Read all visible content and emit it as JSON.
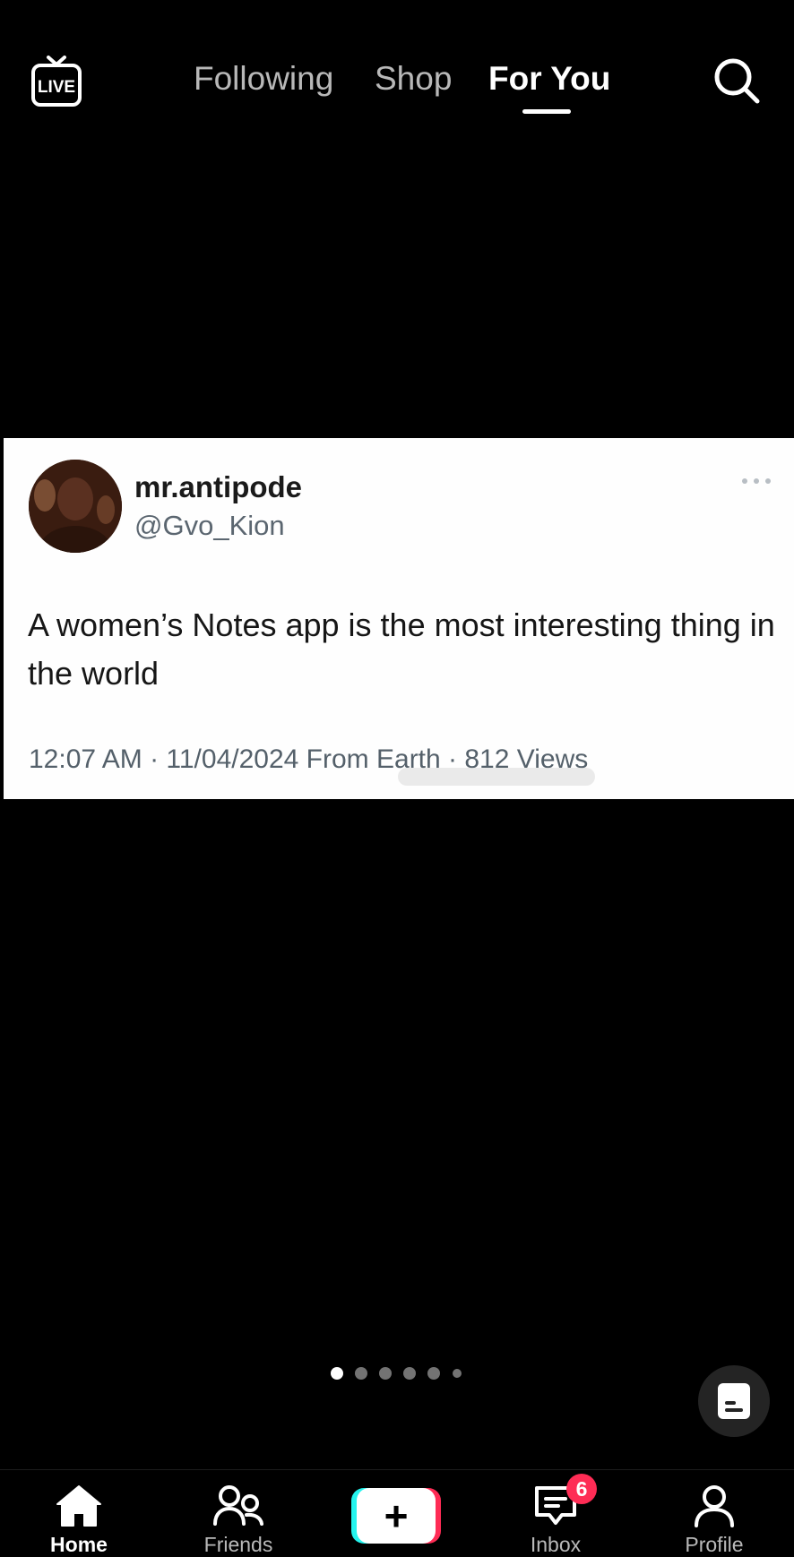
{
  "top_nav": {
    "live_label": "LIVE",
    "tabs": [
      {
        "label": "Following",
        "active": false
      },
      {
        "label": "Shop",
        "active": false
      },
      {
        "label": "For You",
        "active": true
      }
    ],
    "search_icon": "search-icon"
  },
  "post": {
    "display_name": "mr.antipode",
    "handle": "@Gvo_Kion",
    "text": "A women’s Notes app is the most interesting thing in the world",
    "meta": "12:07 AM · 11/04/2024 From Earth · 812 Views",
    "more_icon": "ellipsis-icon"
  },
  "carousel": {
    "count": 6,
    "active_index": 0
  },
  "floating_button": {
    "icon": "notes-icon"
  },
  "bottom_nav": {
    "items": [
      {
        "label": "Home",
        "icon": "home-icon",
        "active": true
      },
      {
        "label": "Friends",
        "icon": "friends-icon",
        "active": false
      },
      {
        "label": "Inbox",
        "icon": "inbox-icon",
        "active": false,
        "badge": "6"
      },
      {
        "label": "Profile",
        "icon": "profile-icon",
        "active": false
      }
    ],
    "create_label": "+"
  },
  "colors": {
    "background": "#000000",
    "card": "#fefefe",
    "badge": "#fe2c55",
    "create_cyan": "#25f4ee",
    "create_pink": "#fe2c55"
  }
}
